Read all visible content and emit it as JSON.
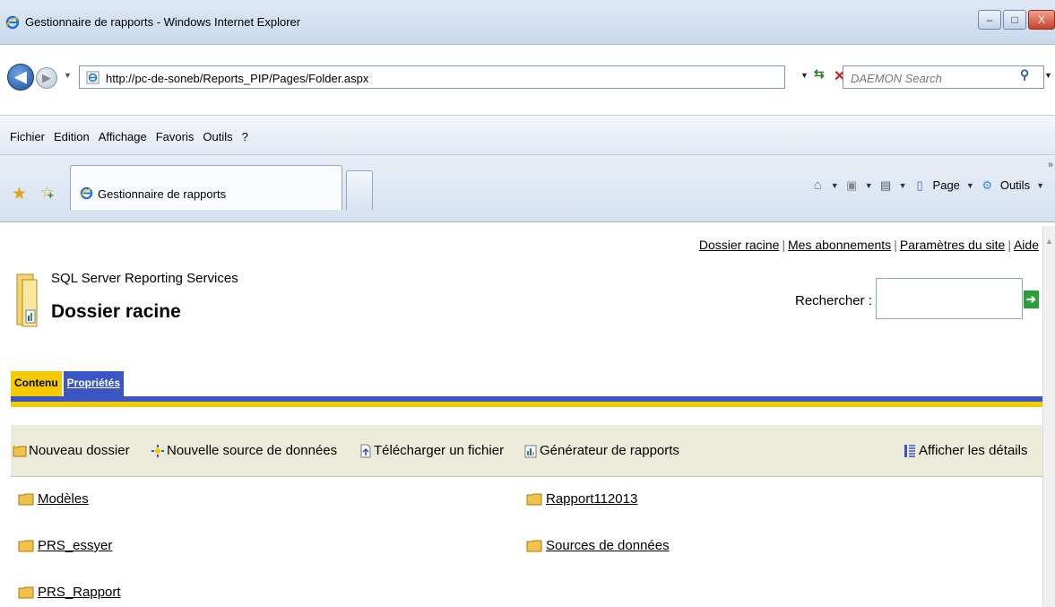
{
  "window": {
    "title": "Gestionnaire de rapports - Windows Internet Explorer",
    "controls": {
      "minimize": "–",
      "maximize": "□",
      "close": "X"
    }
  },
  "address_bar": {
    "url": "http://pc-de-soneb/Reports_PIP/Pages/Folder.aspx",
    "search_placeholder": "DAEMON Search"
  },
  "menu": [
    "Fichier",
    "Edition",
    "Affichage",
    "Favoris",
    "Outils",
    "?"
  ],
  "tab": {
    "title": "Gestionnaire de rapports"
  },
  "command_bar": {
    "page_label": "Page",
    "tools_label": "Outils"
  },
  "page": {
    "top_links": [
      "Dossier racine",
      "Mes abonnements",
      "Paramètres du site",
      "Aide"
    ],
    "product": "SQL Server Reporting Services",
    "title": "Dossier racine",
    "search_label": "Rechercher :",
    "tabs": {
      "active": "Contenu",
      "other": "Propriétés"
    },
    "toolbar": {
      "new_folder": "Nouveau dossier",
      "new_datasource": "Nouvelle source de données",
      "upload": "Télécharger un fichier",
      "report_builder": "Générateur de rapports",
      "show_details": "Afficher les détails"
    },
    "items_left": [
      "Modèles",
      "PRS_essyer",
      "PRS_Rapport"
    ],
    "items_right": [
      "Rapport112013",
      "Sources de données"
    ]
  },
  "colors": {
    "tab_active": "#f5cb00",
    "tab_inactive": "#3a56c4",
    "toolbar_bg": "#ecead8",
    "folder": "#f0c24a"
  }
}
